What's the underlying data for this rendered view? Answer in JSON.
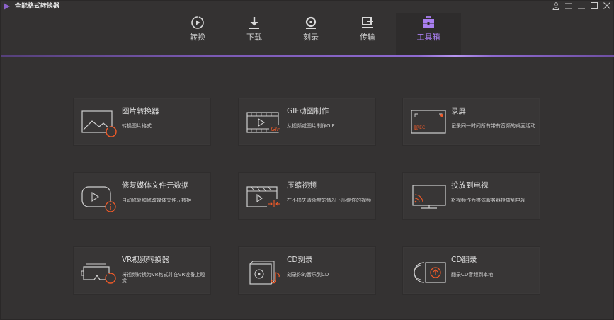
{
  "app": {
    "title": "全能格式转换器"
  },
  "nav": {
    "tabs": [
      {
        "label": "转换",
        "icon": "convert-icon"
      },
      {
        "label": "下载",
        "icon": "download-icon"
      },
      {
        "label": "刻录",
        "icon": "burn-icon"
      },
      {
        "label": "传输",
        "icon": "transfer-icon"
      },
      {
        "label": "工具箱",
        "icon": "toolbox-icon"
      }
    ],
    "active_tab": "工具箱"
  },
  "colors": {
    "accent": "#a97ff0",
    "icon_orange": "#f05a28",
    "background": "#343232",
    "card": "#383636"
  },
  "tools": [
    {
      "title": "图片转换器",
      "desc": "转换图片格式",
      "icon": "image-convert-icon"
    },
    {
      "title": "GIF动图制作",
      "desc": "从视频或图片制作GIF",
      "icon": "gif-maker-icon"
    },
    {
      "title": "录屏",
      "desc": "记录同一时间所有带有音频的桌面活动",
      "icon": "screen-record-icon"
    },
    {
      "title": "修复媒体文件元数据",
      "desc": "自动修复和修改媒体文件元数据",
      "icon": "metadata-fix-icon"
    },
    {
      "title": "压缩视频",
      "desc": "在不损失清晰度的情况下压缩你的视频",
      "icon": "compress-video-icon"
    },
    {
      "title": "投放到电视",
      "desc": "将视频作为媒体服务器投放到电视",
      "icon": "cast-tv-icon"
    },
    {
      "title": "VR视频转换器",
      "desc": "将视频转换为VR格式并在VR设备上观赏",
      "icon": "vr-convert-icon"
    },
    {
      "title": "CD刻录",
      "desc": "刻录你的音乐到CD",
      "icon": "cd-burn-icon"
    },
    {
      "title": "CD翻录",
      "desc": "翻录CD音频到本地",
      "icon": "cd-rip-icon"
    }
  ]
}
